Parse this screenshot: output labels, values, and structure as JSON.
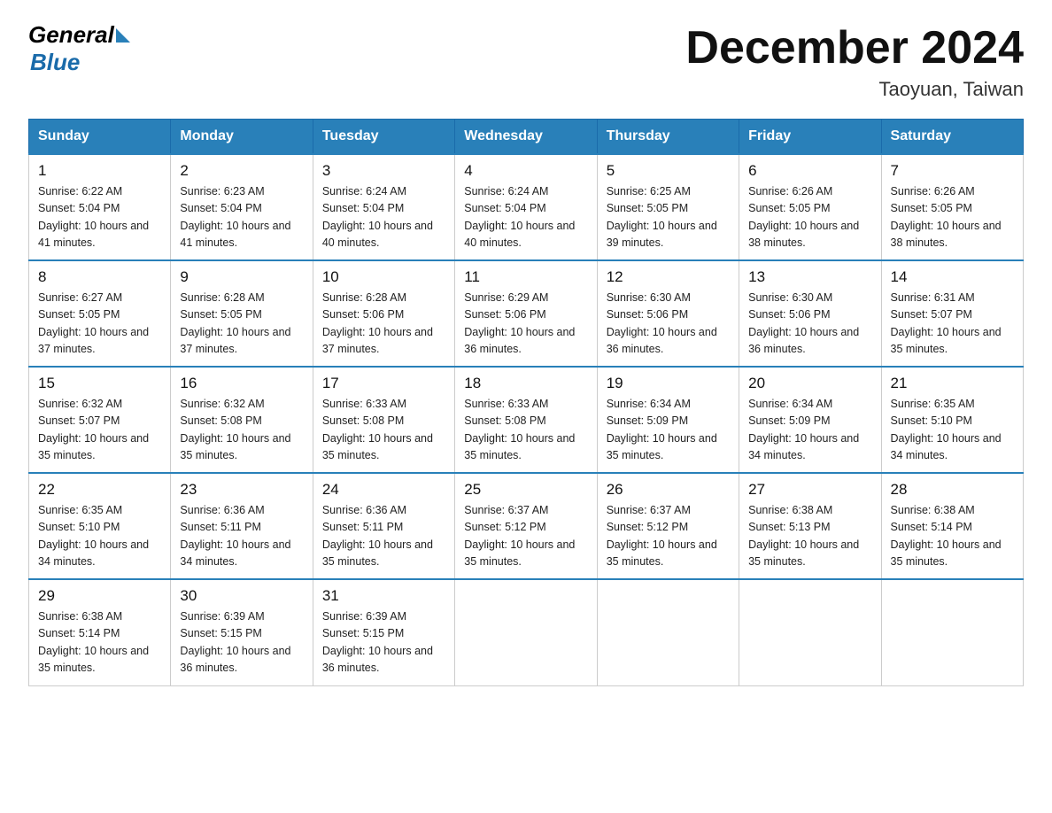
{
  "header": {
    "logo_general": "General",
    "logo_blue": "Blue",
    "month_title": "December 2024",
    "subtitle": "Taoyuan, Taiwan"
  },
  "weekdays": [
    "Sunday",
    "Monday",
    "Tuesday",
    "Wednesday",
    "Thursday",
    "Friday",
    "Saturday"
  ],
  "weeks": [
    [
      {
        "day": "1",
        "sunrise": "6:22 AM",
        "sunset": "5:04 PM",
        "daylight": "10 hours and 41 minutes."
      },
      {
        "day": "2",
        "sunrise": "6:23 AM",
        "sunset": "5:04 PM",
        "daylight": "10 hours and 41 minutes."
      },
      {
        "day": "3",
        "sunrise": "6:24 AM",
        "sunset": "5:04 PM",
        "daylight": "10 hours and 40 minutes."
      },
      {
        "day": "4",
        "sunrise": "6:24 AM",
        "sunset": "5:04 PM",
        "daylight": "10 hours and 40 minutes."
      },
      {
        "day": "5",
        "sunrise": "6:25 AM",
        "sunset": "5:05 PM",
        "daylight": "10 hours and 39 minutes."
      },
      {
        "day": "6",
        "sunrise": "6:26 AM",
        "sunset": "5:05 PM",
        "daylight": "10 hours and 38 minutes."
      },
      {
        "day": "7",
        "sunrise": "6:26 AM",
        "sunset": "5:05 PM",
        "daylight": "10 hours and 38 minutes."
      }
    ],
    [
      {
        "day": "8",
        "sunrise": "6:27 AM",
        "sunset": "5:05 PM",
        "daylight": "10 hours and 37 minutes."
      },
      {
        "day": "9",
        "sunrise": "6:28 AM",
        "sunset": "5:05 PM",
        "daylight": "10 hours and 37 minutes."
      },
      {
        "day": "10",
        "sunrise": "6:28 AM",
        "sunset": "5:06 PM",
        "daylight": "10 hours and 37 minutes."
      },
      {
        "day": "11",
        "sunrise": "6:29 AM",
        "sunset": "5:06 PM",
        "daylight": "10 hours and 36 minutes."
      },
      {
        "day": "12",
        "sunrise": "6:30 AM",
        "sunset": "5:06 PM",
        "daylight": "10 hours and 36 minutes."
      },
      {
        "day": "13",
        "sunrise": "6:30 AM",
        "sunset": "5:06 PM",
        "daylight": "10 hours and 36 minutes."
      },
      {
        "day": "14",
        "sunrise": "6:31 AM",
        "sunset": "5:07 PM",
        "daylight": "10 hours and 35 minutes."
      }
    ],
    [
      {
        "day": "15",
        "sunrise": "6:32 AM",
        "sunset": "5:07 PM",
        "daylight": "10 hours and 35 minutes."
      },
      {
        "day": "16",
        "sunrise": "6:32 AM",
        "sunset": "5:08 PM",
        "daylight": "10 hours and 35 minutes."
      },
      {
        "day": "17",
        "sunrise": "6:33 AM",
        "sunset": "5:08 PM",
        "daylight": "10 hours and 35 minutes."
      },
      {
        "day": "18",
        "sunrise": "6:33 AM",
        "sunset": "5:08 PM",
        "daylight": "10 hours and 35 minutes."
      },
      {
        "day": "19",
        "sunrise": "6:34 AM",
        "sunset": "5:09 PM",
        "daylight": "10 hours and 35 minutes."
      },
      {
        "day": "20",
        "sunrise": "6:34 AM",
        "sunset": "5:09 PM",
        "daylight": "10 hours and 34 minutes."
      },
      {
        "day": "21",
        "sunrise": "6:35 AM",
        "sunset": "5:10 PM",
        "daylight": "10 hours and 34 minutes."
      }
    ],
    [
      {
        "day": "22",
        "sunrise": "6:35 AM",
        "sunset": "5:10 PM",
        "daylight": "10 hours and 34 minutes."
      },
      {
        "day": "23",
        "sunrise": "6:36 AM",
        "sunset": "5:11 PM",
        "daylight": "10 hours and 34 minutes."
      },
      {
        "day": "24",
        "sunrise": "6:36 AM",
        "sunset": "5:11 PM",
        "daylight": "10 hours and 35 minutes."
      },
      {
        "day": "25",
        "sunrise": "6:37 AM",
        "sunset": "5:12 PM",
        "daylight": "10 hours and 35 minutes."
      },
      {
        "day": "26",
        "sunrise": "6:37 AM",
        "sunset": "5:12 PM",
        "daylight": "10 hours and 35 minutes."
      },
      {
        "day": "27",
        "sunrise": "6:38 AM",
        "sunset": "5:13 PM",
        "daylight": "10 hours and 35 minutes."
      },
      {
        "day": "28",
        "sunrise": "6:38 AM",
        "sunset": "5:14 PM",
        "daylight": "10 hours and 35 minutes."
      }
    ],
    [
      {
        "day": "29",
        "sunrise": "6:38 AM",
        "sunset": "5:14 PM",
        "daylight": "10 hours and 35 minutes."
      },
      {
        "day": "30",
        "sunrise": "6:39 AM",
        "sunset": "5:15 PM",
        "daylight": "10 hours and 36 minutes."
      },
      {
        "day": "31",
        "sunrise": "6:39 AM",
        "sunset": "5:15 PM",
        "daylight": "10 hours and 36 minutes."
      },
      null,
      null,
      null,
      null
    ]
  ]
}
